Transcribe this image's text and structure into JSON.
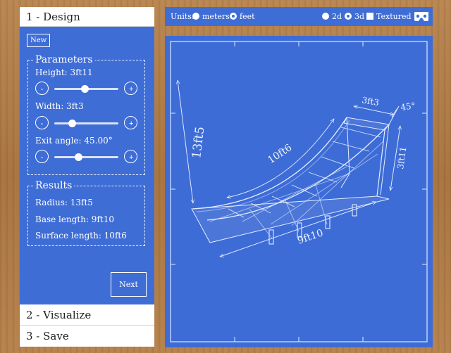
{
  "sidebar": {
    "design_header": "1 - Design",
    "new_label": "New",
    "parameters_title": "Parameters",
    "height_label": "Height: 3ft11",
    "width_label": "Width: 3ft3",
    "exit_angle_label": "Exit angle: 45.00°",
    "minus_label": "-",
    "plus_label": "+",
    "sliders": {
      "height": 0.48,
      "width": 0.28,
      "exit_angle": 0.38
    },
    "results_title": "Results",
    "radius": "Radius: 13ft5",
    "base_length": "Base length: 9ft10",
    "surface_length": "Surface length: 10ft6",
    "next_label": "Next",
    "visualize_header": "2 - Visualize",
    "save_header": "3 - Save"
  },
  "toolbar": {
    "units_label": "Units:",
    "meters_label": "meters",
    "feet_label": "feet",
    "selected_unit": "feet",
    "view_2d_label": "2d",
    "view_3d_label": "3d",
    "selected_view": "3d",
    "textured_label": "Textured",
    "textured_checked": false
  },
  "blueprint": {
    "dim_radius": "13ft5",
    "dim_surface": "10ft6",
    "dim_width": "3ft3",
    "dim_angle": "45°",
    "dim_height": "3ft11",
    "dim_base": "9ft10"
  },
  "colors": {
    "panel_blue": "#3f6dd6",
    "blueprint_blue": "#3d6cd6",
    "wood": "#b07a45"
  }
}
